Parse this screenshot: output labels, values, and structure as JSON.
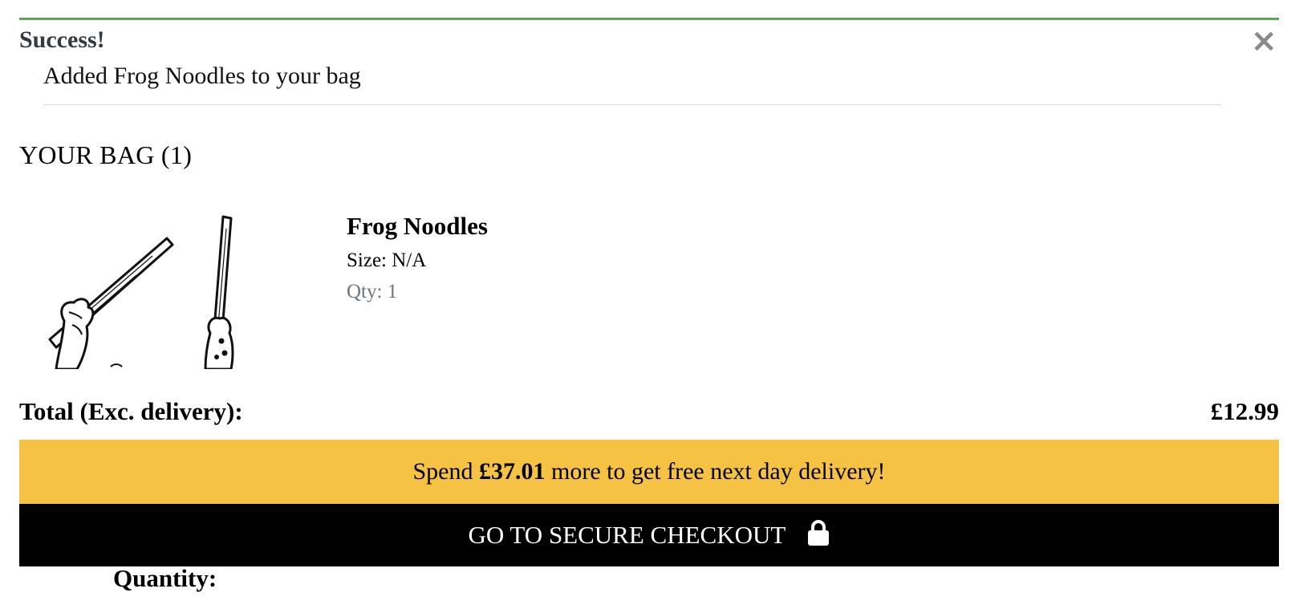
{
  "toast": {
    "title": "Success!",
    "message": "Added Frog Noodles to your bag",
    "close_icon": "close-icon",
    "accent_color": "#5aa84f"
  },
  "bag": {
    "heading": "YOUR BAG (1)"
  },
  "product": {
    "name": "Frog Noodles",
    "size": "Size: N/A",
    "qty": "Qty: 1",
    "image_icon": "hands-holding-sticks-illustration"
  },
  "total": {
    "label": "Total (Exc. delivery):",
    "value": "£12.99"
  },
  "delivery_banner": {
    "prefix": "Spend ",
    "amount": "£37.01",
    "suffix": " more to get free next day delivery!",
    "color": "#f5c244"
  },
  "checkout": {
    "label": "GO TO SECURE CHECKOUT",
    "icon": "lock-icon"
  },
  "quantity": {
    "label": "Quantity:"
  }
}
